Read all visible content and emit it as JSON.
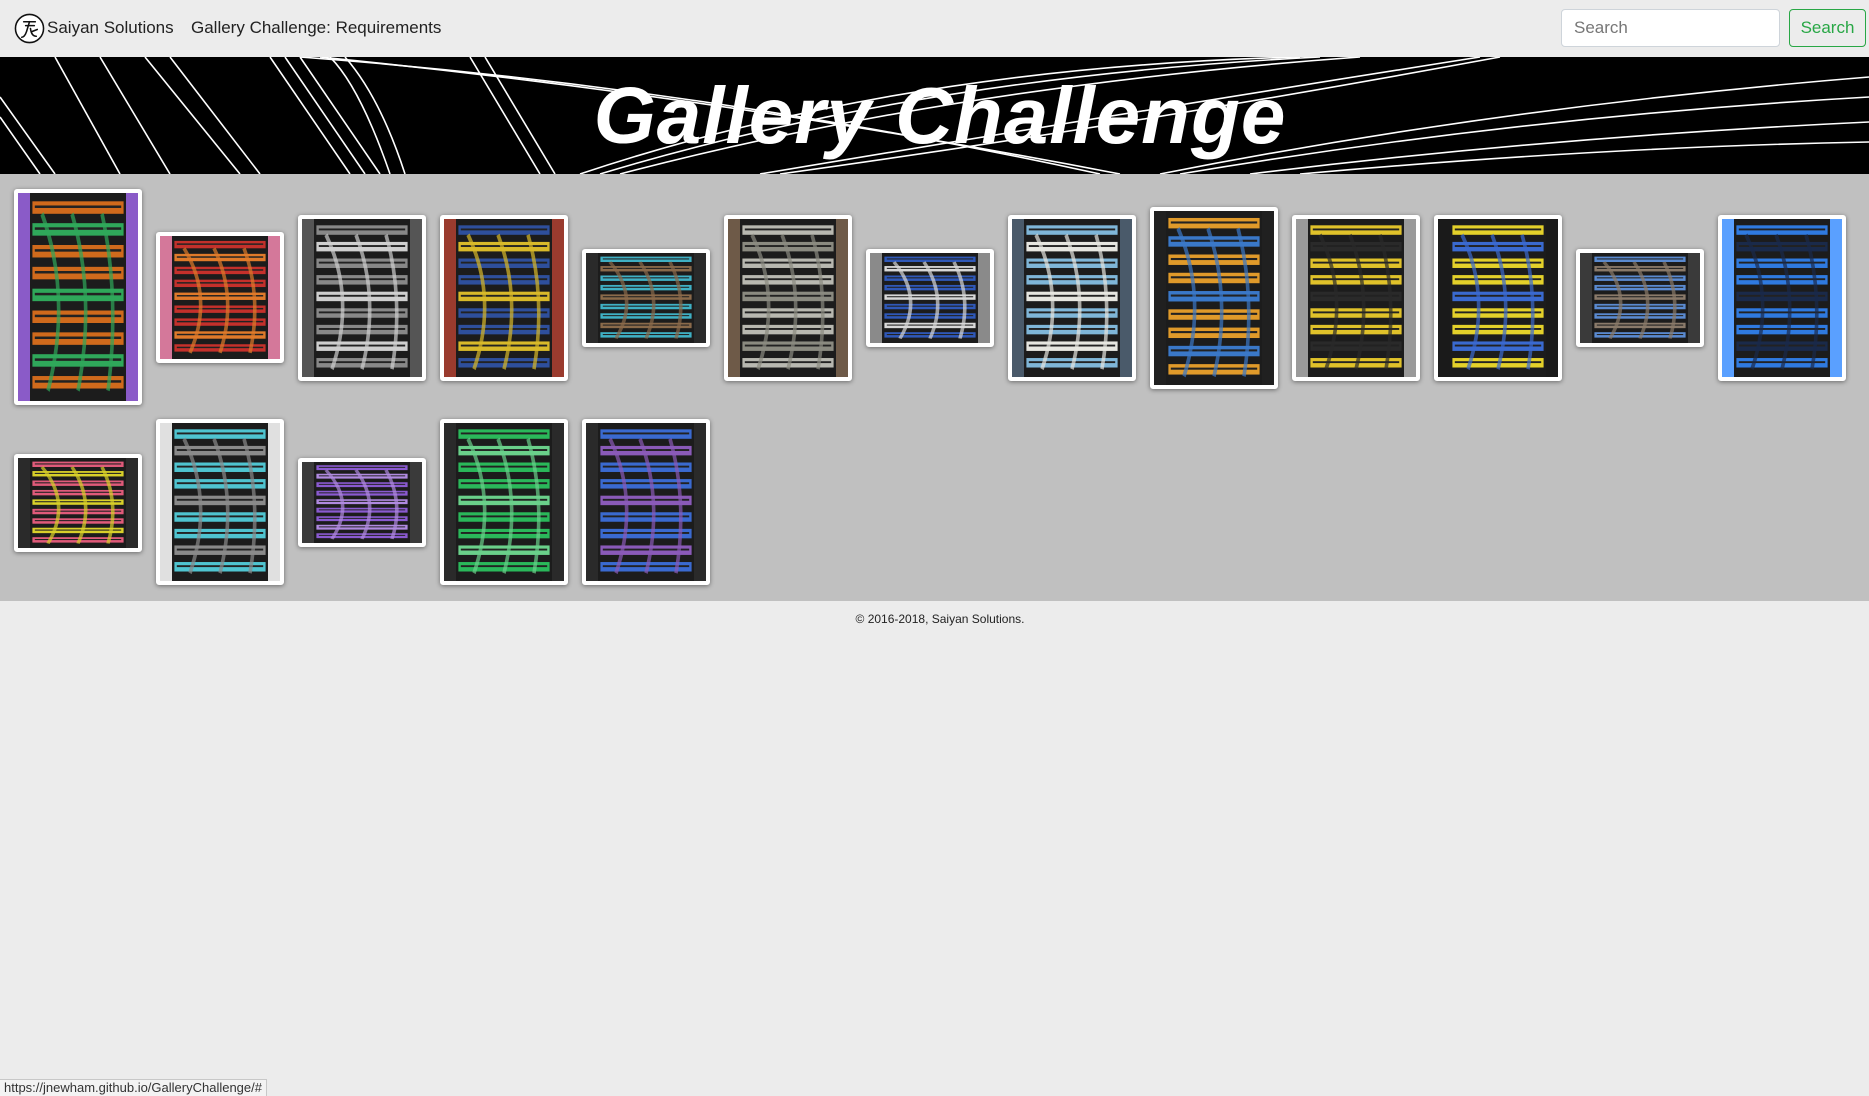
{
  "navbar": {
    "brand": "Saiyan Solutions",
    "links": [
      "Gallery Challenge: Requirements"
    ],
    "search_placeholder": "Search",
    "search_button": "Search"
  },
  "banner": {
    "title": "Gallery Challenge"
  },
  "gallery": {
    "items": [
      {
        "label": "Rack cabling: orange, green and purple patch cables",
        "colors": [
          "#d06a1c",
          "#2fa85a",
          "#8a5bc8"
        ]
      },
      {
        "label": "Patch panel: red, orange, pink, teal cables",
        "colors": [
          "#c4302b",
          "#e07a2a",
          "#d4789a"
        ]
      },
      {
        "label": "Gray cable bundles sweeping down",
        "colors": [
          "#888888",
          "#cfcfcf",
          "#555555"
        ]
      },
      {
        "label": "Blue rack with yellow cables",
        "colors": [
          "#2e4f9c",
          "#d8b92a",
          "#9a3b2e"
        ]
      },
      {
        "label": "Cyan cables in a floor trench",
        "colors": [
          "#3fb0c4",
          "#8a6a4a",
          "#2a2a2a"
        ]
      },
      {
        "label": "Gray cable bundles in a corridor",
        "colors": [
          "#b8b8b0",
          "#8a8a80",
          "#6e5a48"
        ]
      },
      {
        "label": "Blue cables in a wire tray",
        "colors": [
          "#2f58b8",
          "#d8d8d8",
          "#8a8a8a"
        ]
      },
      {
        "label": "Light blue cable bundle on a wall",
        "colors": [
          "#7fb6d8",
          "#e6e6e0",
          "#4a5a6a"
        ]
      },
      {
        "label": "Rack with orange and blue cabling",
        "colors": [
          "#e09a2a",
          "#3a78c8",
          "#202020"
        ]
      },
      {
        "label": "Yellow cables into a patch panel",
        "colors": [
          "#e0c22a",
          "#2a2a2a",
          "#9a9a9a"
        ]
      },
      {
        "label": "Yellow and blue rack patching",
        "colors": [
          "#e4d12a",
          "#3a6ad0",
          "#1a1a1a"
        ]
      },
      {
        "label": "Rows of racks with blue cables",
        "colors": [
          "#5a8ad0",
          "#8a7a6a",
          "#3a3a3a"
        ]
      },
      {
        "label": "Blue cables down a rack",
        "colors": [
          "#2f7ae0",
          "#1a2a4a",
          "#5aa0ff"
        ]
      },
      {
        "label": "Pink and red cable harness",
        "colors": [
          "#e05a7a",
          "#d8d02a",
          "#2a2a2a"
        ]
      },
      {
        "label": "Turquoise cables in a cabinet",
        "colors": [
          "#4fc4d0",
          "#8a8a8a",
          "#e0e0e0"
        ]
      },
      {
        "label": "Purple patch cables",
        "colors": [
          "#8a5ad0",
          "#b08ae0",
          "#3a3a3a"
        ]
      },
      {
        "label": "Green cables in a rack",
        "colors": [
          "#2ab85a",
          "#6ad08a",
          "#2a2a2a"
        ]
      },
      {
        "label": "Blue and purple rack cabling",
        "colors": [
          "#3a6ad0",
          "#8a5ab8",
          "#2a2a2a"
        ]
      }
    ]
  },
  "footer": {
    "copyright": "© 2016-2018, Saiyan Solutions."
  },
  "status_bar": {
    "url": "https://jnewham.github.io/GalleryChallenge/#"
  }
}
